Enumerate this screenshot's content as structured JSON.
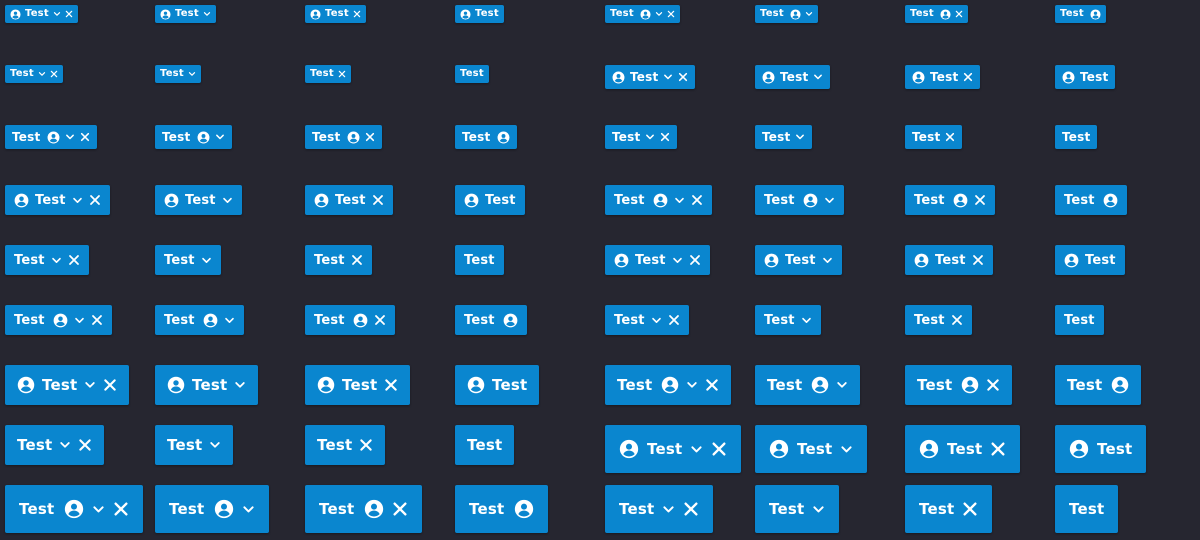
{
  "chip_label": "Test",
  "colors": {
    "background": "#262630",
    "chip": "#0a86cf",
    "chip_text": "#ffffff"
  },
  "icons": {
    "avatar": "account-circle-icon",
    "dropdown": "chevron-down-icon",
    "remove": "close-icon"
  },
  "columns": [
    {
      "leading": false
    },
    {
      "leading": false
    },
    {
      "leading": false
    },
    {
      "leading": false
    },
    {
      "leading": true
    },
    {
      "leading": true
    },
    {
      "leading": true
    },
    {
      "leading": true
    }
  ],
  "grid": [
    [
      "avatar-lead-drop-close",
      "avatar-lead-drop",
      "avatar-lead-close",
      "avatar-lead",
      "avatar-trail-drop-close",
      "avatar-trail-drop",
      "avatar-trail-close",
      "avatar-trail"
    ],
    [
      "drop-close",
      "drop",
      "close",
      "plain",
      "avatar-lead-drop-close",
      "avatar-lead-drop",
      "avatar-lead-close",
      "avatar-lead"
    ],
    [
      "avatar-trail-drop-close",
      "avatar-trail-drop",
      "avatar-trail-close",
      "avatar-trail",
      "drop-close",
      "drop",
      "close",
      "plain"
    ],
    [
      "avatar-lead-drop-close",
      "avatar-lead-drop",
      "avatar-lead-close",
      "avatar-lead",
      "avatar-trail-drop-close",
      "avatar-trail-drop",
      "avatar-trail-close",
      "avatar-trail"
    ],
    [
      "drop-close",
      "drop",
      "close",
      "plain",
      "avatar-lead-drop-close",
      "avatar-lead-drop",
      "avatar-lead-close",
      "avatar-lead"
    ],
    [
      "avatar-trail-drop-close",
      "avatar-trail-drop",
      "avatar-trail-close",
      "avatar-trail",
      "drop-close",
      "drop",
      "close",
      "plain"
    ],
    [
      "avatar-lead-drop-close",
      "avatar-lead-drop",
      "avatar-lead-close",
      "avatar-lead",
      "avatar-trail-drop-close",
      "avatar-trail-drop",
      "avatar-trail-close",
      "avatar-trail"
    ],
    [
      "drop-close",
      "drop",
      "close",
      "plain",
      "avatar-lead-drop-close",
      "avatar-lead-drop",
      "avatar-lead-close",
      "avatar-lead"
    ],
    [
      "avatar-trail-drop-close",
      "avatar-trail-drop",
      "avatar-trail-close",
      "avatar-trail",
      "drop-close",
      "drop",
      "close",
      "plain"
    ]
  ]
}
